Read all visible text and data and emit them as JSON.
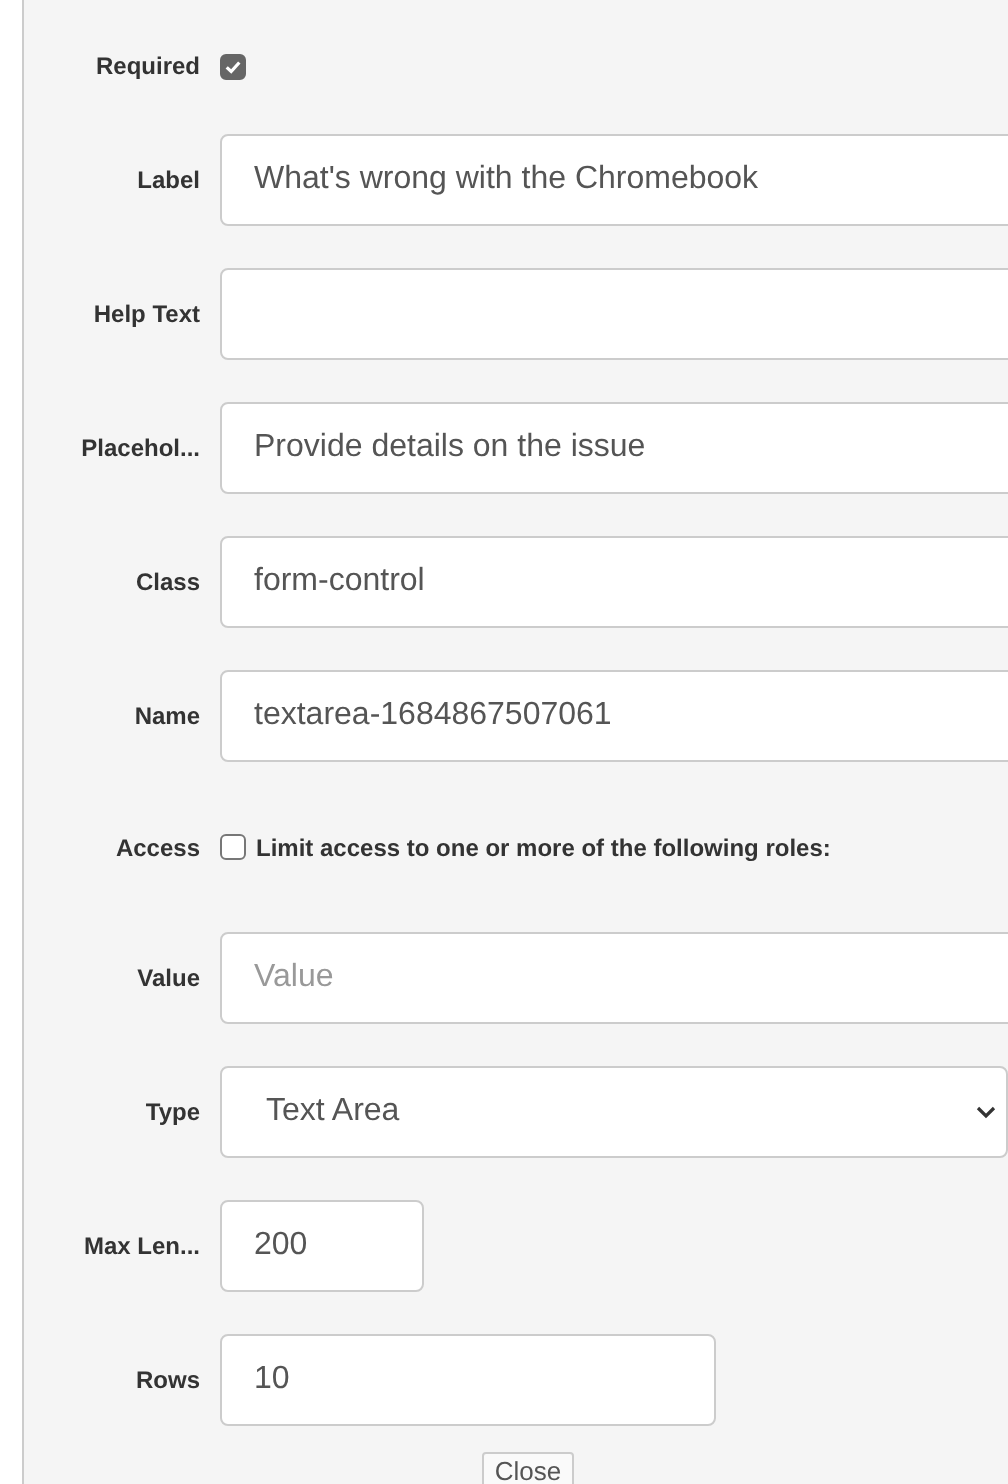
{
  "fields": [
    {
      "kind": "checkbox",
      "label": "Required",
      "checked": true
    },
    {
      "kind": "text",
      "label": "Label",
      "value": "What's wrong with the Chromebook"
    },
    {
      "kind": "text",
      "label": "Help Text"
    },
    {
      "kind": "text",
      "label": "Placehol...",
      "value": "Provide details on the issue"
    },
    {
      "kind": "text",
      "label": "Class",
      "value": "form-control"
    },
    {
      "kind": "text",
      "label": "Name",
      "value": "textarea-1684867507061"
    },
    {
      "kind": "checkbox",
      "label": "Access",
      "checked": false,
      "text": "Limit access to one or more of the following roles:"
    },
    {
      "kind": "text",
      "label": "Value",
      "placeholder": "Value"
    },
    {
      "kind": "select",
      "label": "Type",
      "value": "Text Area"
    },
    {
      "kind": "short",
      "label": "Max Len...",
      "value": "200"
    },
    {
      "kind": "medium",
      "label": "Rows",
      "value": "10"
    }
  ],
  "close_button": "Close"
}
